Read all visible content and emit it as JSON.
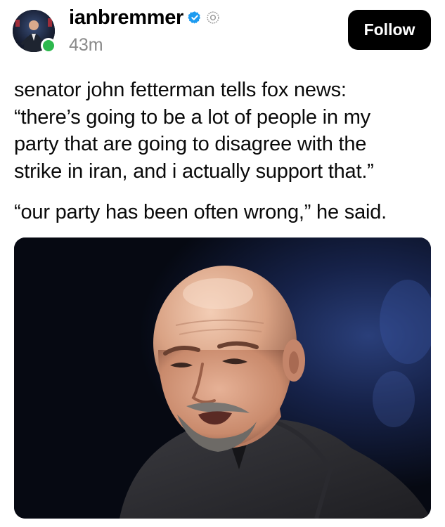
{
  "author": {
    "username": "ianbremmer",
    "timestamp": "43m",
    "verified_icon": "verified-badge-icon",
    "app_icon": "threads-icon",
    "online_color": "#2db84d",
    "verified_color": "#1d9bf0"
  },
  "follow": {
    "label": "Follow",
    "bg_color": "#000000"
  },
  "post": {
    "paragraph_1": "senator john fetterman tells fox news:\n“there’s going to be a lot of people in my\nparty that are going to disagree with the\nstrike in iran, and i actually support that.”",
    "paragraph_2": "“our party has been often wrong,” he said."
  },
  "media": {
    "type": "photo",
    "subject": "photo-of-bald-man"
  }
}
